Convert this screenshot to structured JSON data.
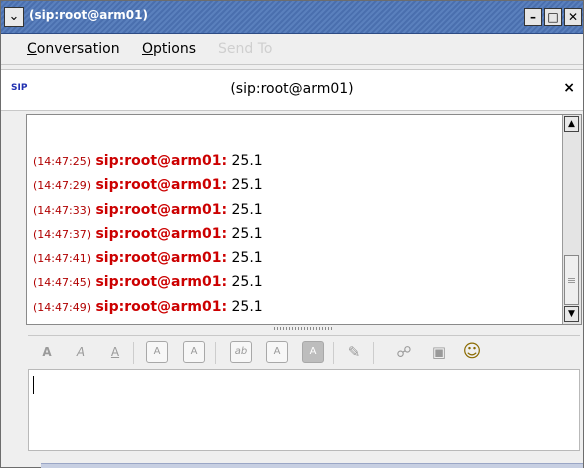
{
  "window": {
    "title": "(sip:root@arm01)",
    "controls": {
      "menu_glyph": "⌄",
      "minimize": "–",
      "maximize": "□",
      "close": "✕"
    }
  },
  "menu": {
    "conversation": {
      "first": "C",
      "rest": "onversation"
    },
    "options": {
      "first": "O",
      "rest": "ptions"
    },
    "send_to": "Send To"
  },
  "conversation_header": {
    "protocol": "SIP",
    "title": "(sip:root@arm01)",
    "close": "×"
  },
  "messages": [
    {
      "time": "(14:47:25)",
      "sender": "sip:root@arm01:",
      "text": "25.1"
    },
    {
      "time": "(14:47:29)",
      "sender": "sip:root@arm01:",
      "text": "25.1"
    },
    {
      "time": "(14:47:33)",
      "sender": "sip:root@arm01:",
      "text": "25.1"
    },
    {
      "time": "(14:47:37)",
      "sender": "sip:root@arm01:",
      "text": "25.1"
    },
    {
      "time": "(14:47:41)",
      "sender": "sip:root@arm01:",
      "text": "25.1"
    },
    {
      "time": "(14:47:45)",
      "sender": "sip:root@arm01:",
      "text": "25.1"
    },
    {
      "time": "(14:47:49)",
      "sender": "sip:root@arm01:",
      "text": "25.1"
    }
  ],
  "scrollbar": {
    "up": "▲",
    "down": "▼"
  },
  "toolbar": {
    "bold": "A",
    "italic": "A",
    "underline": "A",
    "grow_font": "A",
    "shrink_font": "A",
    "font_face": "ab",
    "fg_color": "A",
    "bg_color": "A",
    "clear": "✎",
    "link": "☍",
    "image": "▣",
    "smiley": "☺"
  },
  "colors": {
    "title_bar": "#4a6fae",
    "sender": "#cc0000",
    "timestamp": "#b00000"
  },
  "icons": [
    "window-menu-icon",
    "minimize-icon",
    "maximize-icon",
    "close-icon",
    "sip-protocol-icon",
    "scroll-up-icon",
    "scroll-down-icon",
    "link-icon",
    "image-icon",
    "smiley-icon",
    "eraser-icon"
  ]
}
